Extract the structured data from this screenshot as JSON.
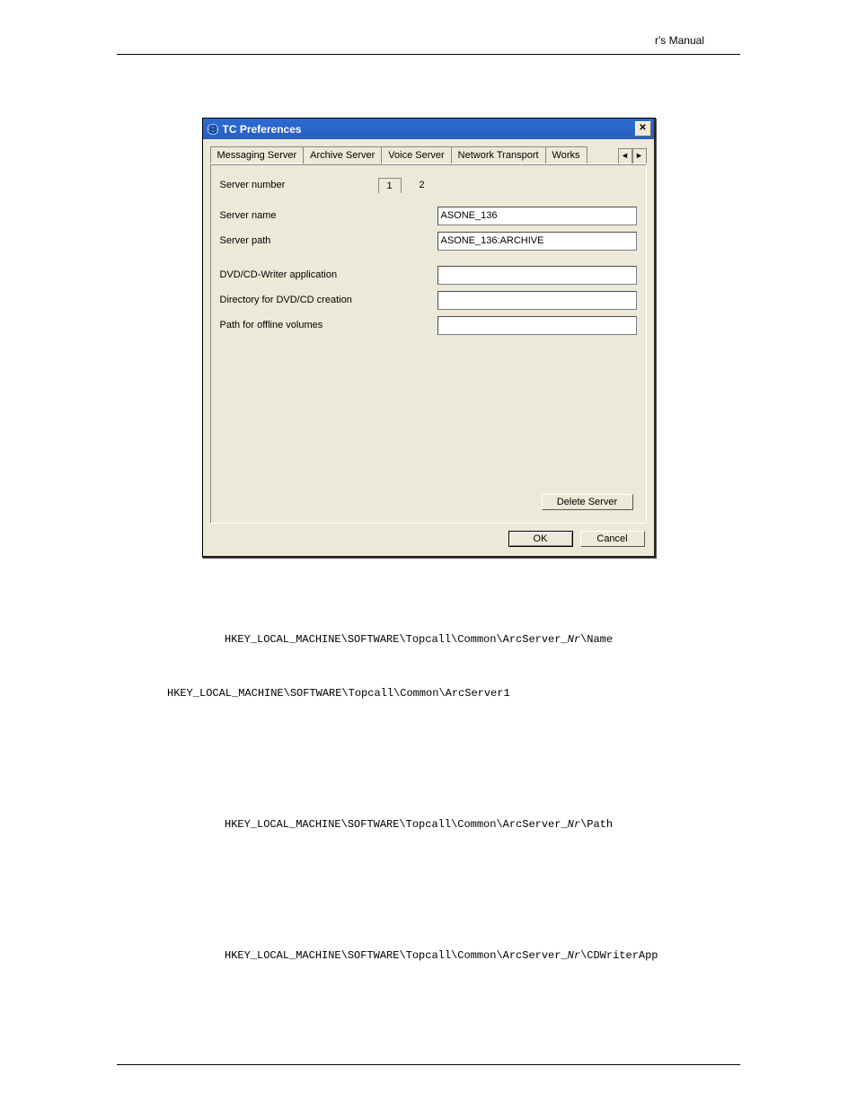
{
  "page_header_fragment": "r's Manual",
  "dialog": {
    "title": "TC Preferences",
    "tabs": [
      "Messaging Server",
      "Archive Server",
      "Voice Server",
      "Network Transport",
      "Works"
    ],
    "active_tab_index": 1,
    "server_number": {
      "label": "Server number",
      "values": [
        "1",
        "2"
      ],
      "active_index": 0
    },
    "fields": {
      "server_name": {
        "label": "Server name",
        "value": "ASONE_136"
      },
      "server_path": {
        "label": "Server path",
        "value": "ASONE_136:ARCHIVE"
      },
      "dvd_app": {
        "label": "DVD/CD-Writer application",
        "value": ""
      },
      "dvd_dir": {
        "label": "Directory for DVD/CD creation",
        "value": ""
      },
      "offline": {
        "label": "Path for offline volumes",
        "value": ""
      }
    },
    "delete_btn": "Delete Server",
    "ok_btn": "OK",
    "cancel_btn": "Cancel"
  },
  "registry": {
    "name_key_pre": "HKEY_LOCAL_MACHINE\\SOFTWARE\\Topcall\\Common\\ArcServer_",
    "name_key_post": "\\Name",
    "example": "HKEY_LOCAL_MACHINE\\SOFTWARE\\Topcall\\Common\\ArcServer1",
    "path_key_pre": "HKEY_LOCAL_MACHINE\\SOFTWARE\\Topcall\\Common\\ArcServer_",
    "path_key_post": "\\Path",
    "cd_key_pre": "HKEY_LOCAL_MACHINE\\SOFTWARE\\Topcall\\Common\\ArcServer_",
    "cd_key_post": "\\CDWriterApp",
    "nr": "Nr"
  }
}
